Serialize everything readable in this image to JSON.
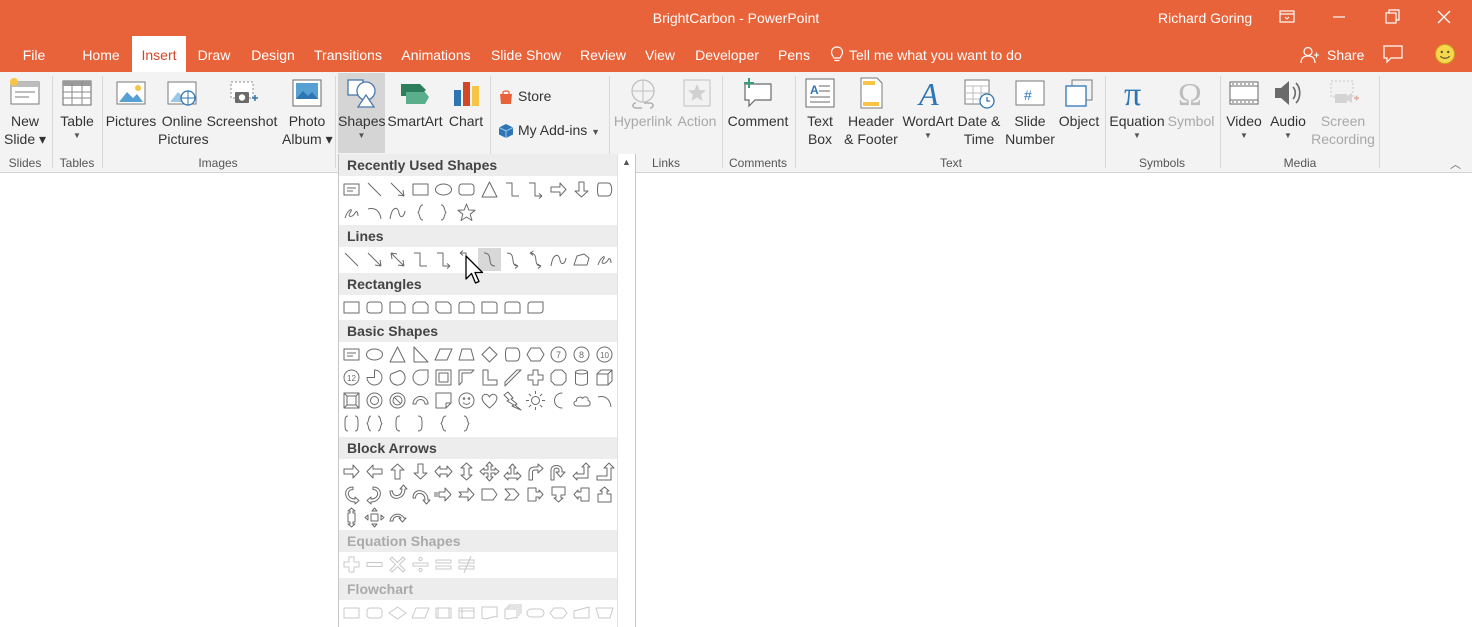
{
  "window": {
    "title": "BrightCarbon  -  PowerPoint",
    "user": "Richard Goring",
    "accent": "#E8633A"
  },
  "tabs": [
    {
      "label": "File"
    },
    {
      "label": "Home"
    },
    {
      "label": "Insert"
    },
    {
      "label": "Draw"
    },
    {
      "label": "Design"
    },
    {
      "label": "Transitions"
    },
    {
      "label": "Animations"
    },
    {
      "label": "Slide Show"
    },
    {
      "label": "Review"
    },
    {
      "label": "View"
    },
    {
      "label": "Developer"
    },
    {
      "label": "Pens"
    }
  ],
  "active_tab": "Insert",
  "tellme": "Tell me what you want to do",
  "share": "Share",
  "ribbon": {
    "slides": {
      "new_slide_1": "New",
      "new_slide_2": "Slide",
      "label": "Slides"
    },
    "tables": {
      "table": "Table",
      "label": "Tables"
    },
    "images": {
      "pictures": "Pictures",
      "online_1": "Online",
      "online_2": "Pictures",
      "screenshot": "Screenshot",
      "photo_1": "Photo",
      "photo_2": "Album",
      "label": "Images"
    },
    "illustrations": {
      "shapes": "Shapes",
      "smartart": "SmartArt",
      "chart": "Chart"
    },
    "addins": {
      "store": "Store",
      "myaddins": "My Add-ins"
    },
    "links": {
      "hyperlink": "Hyperlink",
      "action": "Action",
      "label": "Links"
    },
    "comments": {
      "comment": "Comment",
      "label": "Comments"
    },
    "text": {
      "textbox_1": "Text",
      "textbox_2": "Box",
      "header_1": "Header",
      "header_2": "& Footer",
      "wordart": "WordArt",
      "datetime_1": "Date &",
      "datetime_2": "Time",
      "slidenum_1": "Slide",
      "slidenum_2": "Number",
      "object": "Object",
      "label": "Text"
    },
    "symbols": {
      "equation": "Equation",
      "symbol": "Symbol",
      "label": "Symbols"
    },
    "media": {
      "video": "Video",
      "audio": "Audio",
      "rec_1": "Screen",
      "rec_2": "Recording",
      "label": "Media"
    }
  },
  "shapes_panel": {
    "sections": [
      {
        "title": "Recently Used Shapes"
      },
      {
        "title": "Lines"
      },
      {
        "title": "Rectangles"
      },
      {
        "title": "Basic Shapes"
      },
      {
        "title": "Block Arrows"
      },
      {
        "title": "Equation Shapes"
      },
      {
        "title": "Flowchart"
      }
    ],
    "rows": {
      "recent": [
        [
          "textbox",
          "line",
          "arrow",
          "rect",
          "oval",
          "roundrect",
          "triangle",
          "elbow",
          "elbowarrow",
          "rightarrow",
          "downarrow",
          "pentagon"
        ],
        [
          "scribble",
          "arc",
          "curve",
          "lbrace",
          "rbrace",
          "star"
        ]
      ],
      "lines": [
        [
          "line",
          "arrow",
          "dblarrow",
          "elbow",
          "elbowarrow",
          "elbowdbl",
          "curved",
          "curvedarrow",
          "curveddbl",
          "curve",
          "freeform",
          "scribble"
        ]
      ],
      "rectangles": [
        [
          "rect",
          "roundrect",
          "snip1",
          "snip2",
          "snipdiag",
          "sniprnd",
          "rnd1",
          "rnd2",
          "rnddiag"
        ]
      ],
      "basic": [
        [
          "textbox",
          "oval",
          "triangle",
          "rtriangle",
          "parallelogram",
          "trapezoid",
          "diamond",
          "pentagon",
          "hexagon",
          "n7",
          "n8",
          "n10"
        ],
        [
          "n12",
          "pie",
          "chord",
          "teardrop",
          "frame",
          "halfframe",
          "lshape",
          "diagstripe",
          "plus",
          "octagon",
          "can",
          "cube"
        ],
        [
          "bevel",
          "donut",
          "nosymbol",
          "blockarc",
          "foldedcorner",
          "smiley",
          "heart",
          "lightning",
          "sun",
          "moon",
          "cloud",
          "arc"
        ],
        [
          "dblbracket",
          "dblbrace",
          "lbracket",
          "rbracket",
          "lbrace",
          "rbrace"
        ]
      ],
      "block": [
        [
          "rightarrow",
          "leftarrow",
          "uparrow",
          "downarrow",
          "lrarrow",
          "udarrow",
          "quadarrow",
          "lruarrow",
          "bentarrow",
          "uturn",
          "leftup",
          "bentup"
        ],
        [
          "curvedright",
          "curvedleft",
          "curvedup",
          "curveddown",
          "stripedright",
          "notchedright",
          "homeplate",
          "chevron",
          "rightcallout",
          "downcallout",
          "leftcallout",
          "upcallout"
        ],
        [
          "udcallout",
          "quadcallout",
          "circular"
        ]
      ],
      "equation": [
        [
          "plus",
          "minus",
          "multiply",
          "divide",
          "equal",
          "notequal"
        ]
      ],
      "flowchart": [
        [
          "process",
          "alternate",
          "decision",
          "data",
          "predefined",
          "internal",
          "document",
          "multidoc",
          "terminator",
          "preparation",
          "manualinput",
          "manualop"
        ]
      ]
    }
  }
}
